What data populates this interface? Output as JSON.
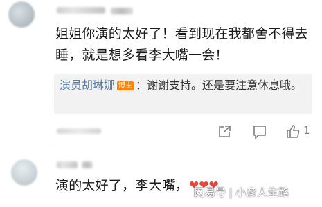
{
  "comments": [
    {
      "text_line1": "姐姐你演的太好了！看到现在我都舍不得去",
      "text_line2": "睡，就是想多看李大嘴一会！",
      "reply": {
        "author": "演员胡琳娜",
        "badge": "博主",
        "text": "：谢谢支持。还是要注意休息哦。"
      },
      "like_count": "1"
    },
    {
      "text": "演的太好了，李大嘴，"
    }
  ],
  "icons": {
    "share": "share-icon",
    "comment": "comment-icon",
    "like": "thumbs-up-icon",
    "heart": "heart-icon"
  },
  "colors": {
    "reply_author": "#5a7ba6",
    "badge": "#ff8200",
    "heart": "#e8453c",
    "reply_background": "#f2f2f2"
  },
  "watermark": {
    "platform": "网易号",
    "channel": "小彦人生路"
  }
}
